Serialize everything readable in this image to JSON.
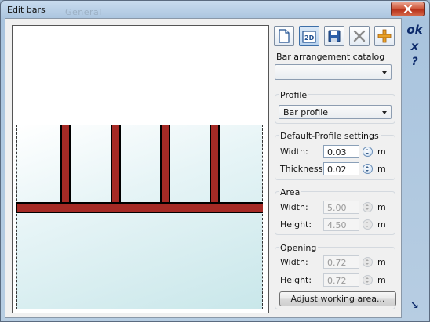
{
  "window": {
    "title": "Edit bars",
    "background_label": "General"
  },
  "toolbar": {
    "buttons": [
      {
        "name": "new-document-icon",
        "tooltip": ""
      },
      {
        "name": "2d-view-icon",
        "text": "2D"
      },
      {
        "name": "save-icon",
        "tooltip": ""
      },
      {
        "name": "delete-icon",
        "tooltip": ""
      },
      {
        "name": "add-bar-icon",
        "tooltip": ""
      }
    ]
  },
  "catalog": {
    "label": "Bar arrangement catalog",
    "value": ""
  },
  "profile": {
    "group_title": "Profile",
    "value": "Bar profile"
  },
  "default_profile": {
    "group_title": "Default-Profile settings",
    "width_label": "Width:",
    "width_value": "0.03",
    "width_unit": "m",
    "thickness_label": "Thickness:",
    "thickness_value": "0.02",
    "thickness_unit": "m"
  },
  "area": {
    "group_title": "Area",
    "width_label": "Width:",
    "width_value": "5.00",
    "width_unit": "m",
    "height_label": "Height:",
    "height_value": "4.50",
    "height_unit": "m"
  },
  "opening": {
    "group_title": "Opening",
    "width_label": "Width:",
    "width_value": "0.72",
    "width_unit": "m",
    "height_label": "Height:",
    "height_value": "0.72",
    "height_unit": "m"
  },
  "adjust_button": "Adjust working area...",
  "side": {
    "ok": "ok",
    "cancel": "x",
    "help": "?",
    "resize": "↘"
  },
  "colors": {
    "bar_fill": "#a52a25",
    "bar_outline": "#000000",
    "accent": "#0c2a6b"
  }
}
